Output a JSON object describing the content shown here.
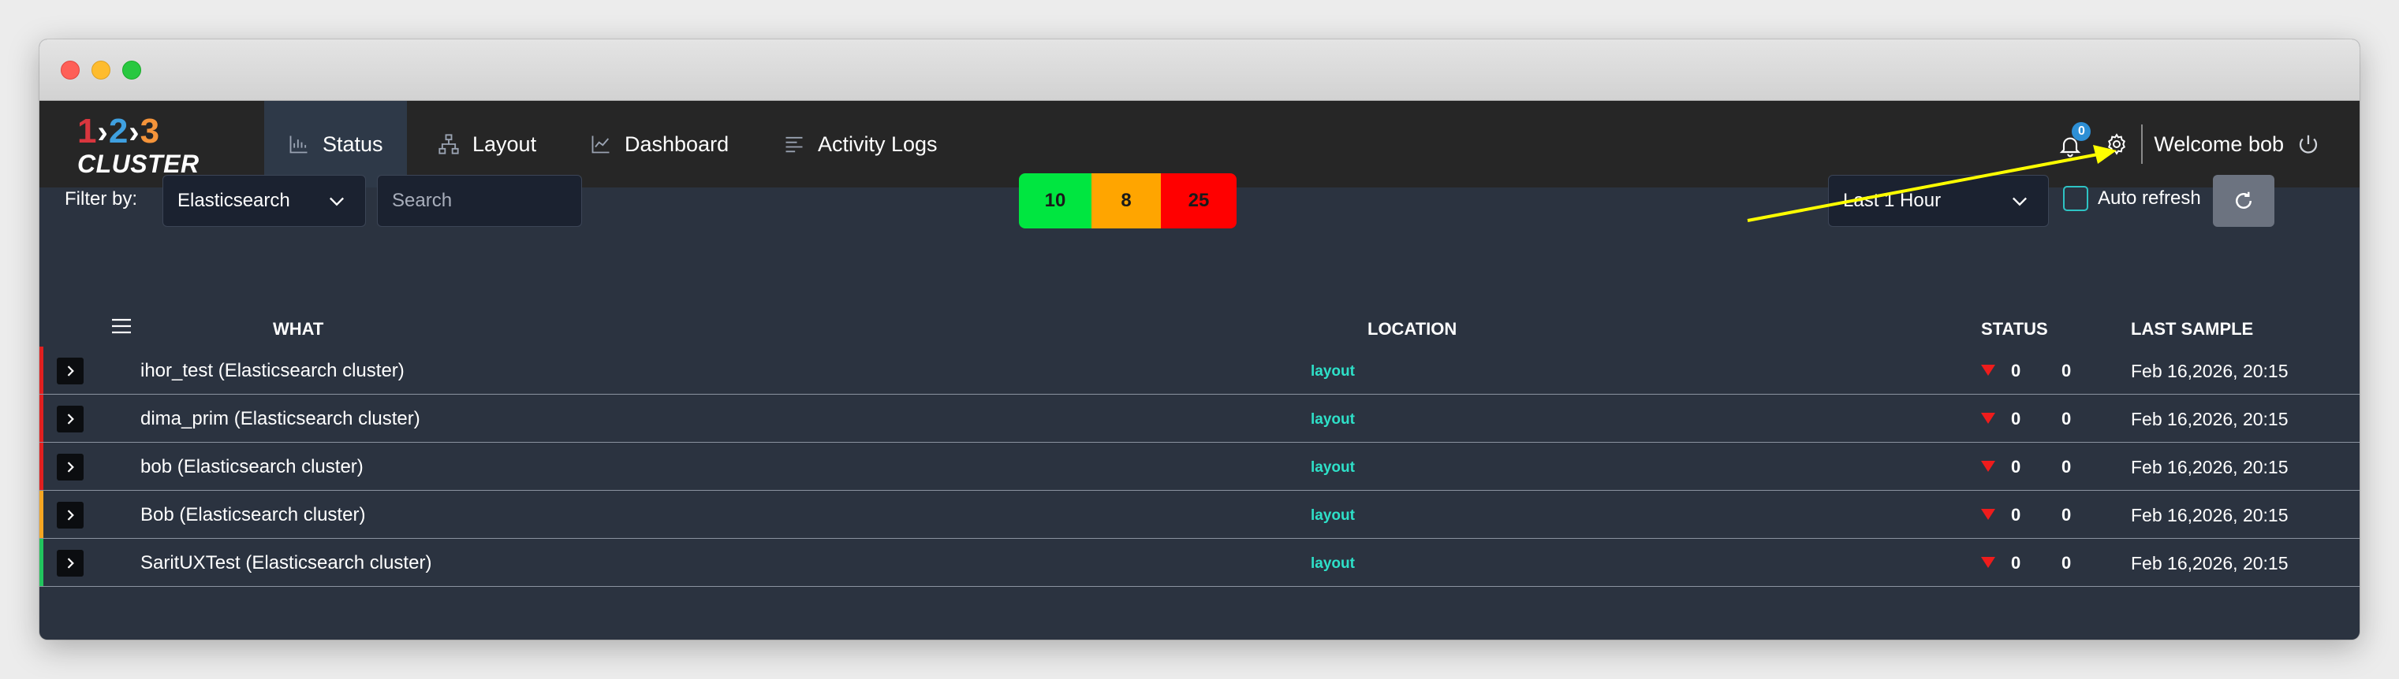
{
  "window": {
    "traffic_lights": [
      "close",
      "minimize",
      "zoom"
    ]
  },
  "nav": {
    "logo": {
      "d1": "1",
      "d2": "2",
      "d3": "3",
      "sep": "›",
      "word": "CLUSTER"
    },
    "items": [
      {
        "label": "Status",
        "icon": "bar-chart-icon",
        "active": true
      },
      {
        "label": "Layout",
        "icon": "sitemap-icon",
        "active": false
      },
      {
        "label": "Dashboard",
        "icon": "line-chart-icon",
        "active": false
      },
      {
        "label": "Activity Logs",
        "icon": "align-left-icon",
        "active": false
      }
    ],
    "notifications_count": "0",
    "welcome": "Welcome bob"
  },
  "toolbar": {
    "filter_label": "Filter by:",
    "filter_value": "Elasticsearch",
    "search_placeholder": "Search",
    "counts": {
      "green": "10",
      "orange": "8",
      "red": "25"
    },
    "time_range": "Last 1 Hour",
    "auto_refresh_label": "Auto refresh",
    "auto_refresh_checked": false
  },
  "table": {
    "headers": {
      "what": "WHAT",
      "location": "LOCATION",
      "status": "STATUS",
      "last_sample": "LAST SAMPLE"
    },
    "rows": [
      {
        "what": "ihor_test (Elasticsearch cluster)",
        "location": "layout",
        "status_a": "0",
        "status_b": "0",
        "last_sample": "Feb 16,2026, 20:15",
        "severity_color": "#e02020"
      },
      {
        "what": "dima_prim (Elasticsearch cluster)",
        "location": "layout",
        "status_a": "0",
        "status_b": "0",
        "last_sample": "Feb 16,2026, 20:15",
        "severity_color": "#e02020"
      },
      {
        "what": "bob (Elasticsearch cluster)",
        "location": "layout",
        "status_a": "0",
        "status_b": "0",
        "last_sample": "Feb 16,2026, 20:15",
        "severity_color": "#e02020"
      },
      {
        "what": "Bob (Elasticsearch cluster)",
        "location": "layout",
        "status_a": "0",
        "status_b": "0",
        "last_sample": "Feb 16,2026, 20:15",
        "severity_color": "#f5a623"
      },
      {
        "what": "SaritUXTest (Elasticsearch cluster)",
        "location": "layout",
        "status_a": "0",
        "status_b": "0",
        "last_sample": "Feb 16,2026, 20:15",
        "severity_color": "#22c55e"
      }
    ]
  },
  "colors": {
    "status_up": "#00e640",
    "status_warn": "#ffa500",
    "status_down": "#ff0000",
    "link": "#2ee0c8",
    "annotation_arrow": "#ffff00"
  }
}
